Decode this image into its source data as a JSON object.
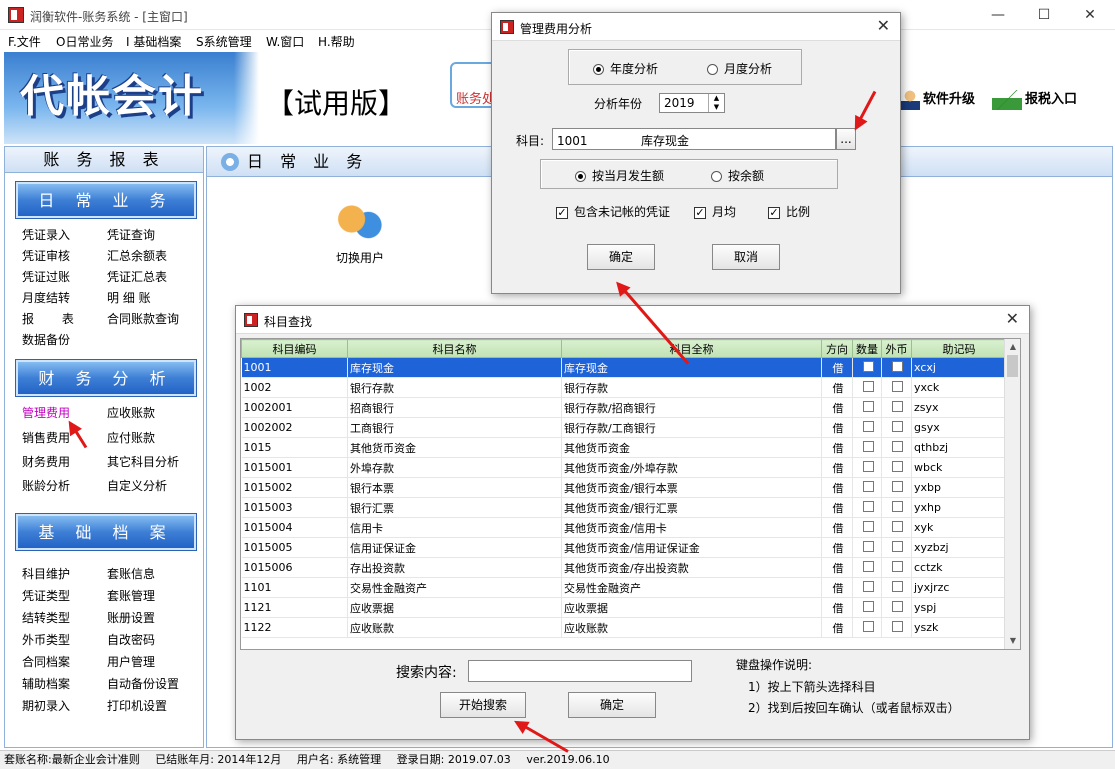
{
  "window": {
    "title": "润衡软件-账务系统 - [主窗口]"
  },
  "menu": [
    "F.文件",
    "O日常业务",
    "I 基础档案",
    "S系统管理",
    "W.窗口",
    "H.帮助"
  ],
  "banner": {
    "logo": "代帐会计",
    "trial": "【试用版】",
    "service_label": "账务处",
    "upgrade": "软件升级",
    "tax": "报税入口"
  },
  "sidebar": {
    "title": "账 务 报 表",
    "groups": [
      {
        "title": "日 常 业 务",
        "items": [
          "凭证录入",
          "凭证查询",
          "凭证审核",
          "汇总余额表",
          "凭证过账",
          "凭证汇总表",
          "月度结转",
          "明 细 账",
          "报 表",
          "合同账款查询",
          "数据备份"
        ]
      },
      {
        "title": "财 务 分 析",
        "items": [
          "管理费用",
          "应收账款",
          "销售费用",
          "应付账款",
          "财务费用",
          "其它科目分析",
          "账龄分析",
          "自定义分析"
        ]
      },
      {
        "title": "基 础 档 案",
        "items": [
          "科目维护",
          "套账信息",
          "凭证类型",
          "套账管理",
          "结转类型",
          "账册设置",
          "外币类型",
          "自改密码",
          "合同档案",
          "用户管理",
          "辅助档案",
          "自动备份设置",
          "期初录入",
          "打印机设置"
        ]
      }
    ]
  },
  "content": {
    "title": "日 常 业 务",
    "switch_user": "切换用户"
  },
  "status": {
    "book": "套账名称:最新企业会计准则",
    "closed": "已结账年月: 2014年12月",
    "user": "用户名: 系统管理",
    "login": "登录日期: 2019.07.03",
    "ver": "ver.2019.06.10"
  },
  "expense_dialog": {
    "title": "管理费用分析",
    "radio_year": "年度分析",
    "radio_month": "月度分析",
    "year_label": "分析年份",
    "year_value": "2019",
    "subject_label": "科目:",
    "subject_value": "1001              库存现金",
    "browse": "...",
    "radio_current": "按当月发生额",
    "radio_balance": "按余额",
    "check_unposted": "包含未记帐的凭证",
    "check_monthly": "月均",
    "check_ratio": "比例",
    "ok": "确定",
    "cancel": "取消"
  },
  "subject_dialog": {
    "title": "科目查找",
    "columns": [
      "科目编码",
      "科目名称",
      "科目全称",
      "方向",
      "数量",
      "外币",
      "助记码"
    ],
    "rows": [
      [
        "1001",
        "库存现金",
        "库存现金",
        "借",
        "xcxj"
      ],
      [
        "1002",
        "银行存款",
        "银行存款",
        "借",
        "yxck"
      ],
      [
        "1002001",
        "招商银行",
        "银行存款/招商银行",
        "借",
        "zsyx"
      ],
      [
        "1002002",
        "工商银行",
        "银行存款/工商银行",
        "借",
        "gsyx"
      ],
      [
        "1015",
        "其他货币资金",
        "其他货币资金",
        "借",
        "qthbzj"
      ],
      [
        "1015001",
        "外埠存款",
        "其他货币资金/外埠存款",
        "借",
        "wbck"
      ],
      [
        "1015002",
        "银行本票",
        "其他货币资金/银行本票",
        "借",
        "yxbp"
      ],
      [
        "1015003",
        "银行汇票",
        "其他货币资金/银行汇票",
        "借",
        "yxhp"
      ],
      [
        "1015004",
        "信用卡",
        "其他货币资金/信用卡",
        "借",
        "xyk"
      ],
      [
        "1015005",
        "信用证保证金",
        "其他货币资金/信用证保证金",
        "借",
        "xyzbzj"
      ],
      [
        "1015006",
        "存出投资款",
        "其他货币资金/存出投资款",
        "借",
        "cctzk"
      ],
      [
        "1101",
        "交易性金融资产",
        "交易性金融资产",
        "借",
        "jyxjrzc"
      ],
      [
        "1121",
        "应收票据",
        "应收票据",
        "借",
        "yspj"
      ],
      [
        "1122",
        "应收账款",
        "应收账款",
        "借",
        "yszk"
      ]
    ],
    "search_label": "搜索内容:",
    "search_value": "",
    "search_button": "开始搜索",
    "ok": "确定",
    "help_title": "键盘操作说明:",
    "help_1": "1）按上下箭头选择科目",
    "help_2": "2）找到后按回车确认（或者鼠标双击）"
  }
}
